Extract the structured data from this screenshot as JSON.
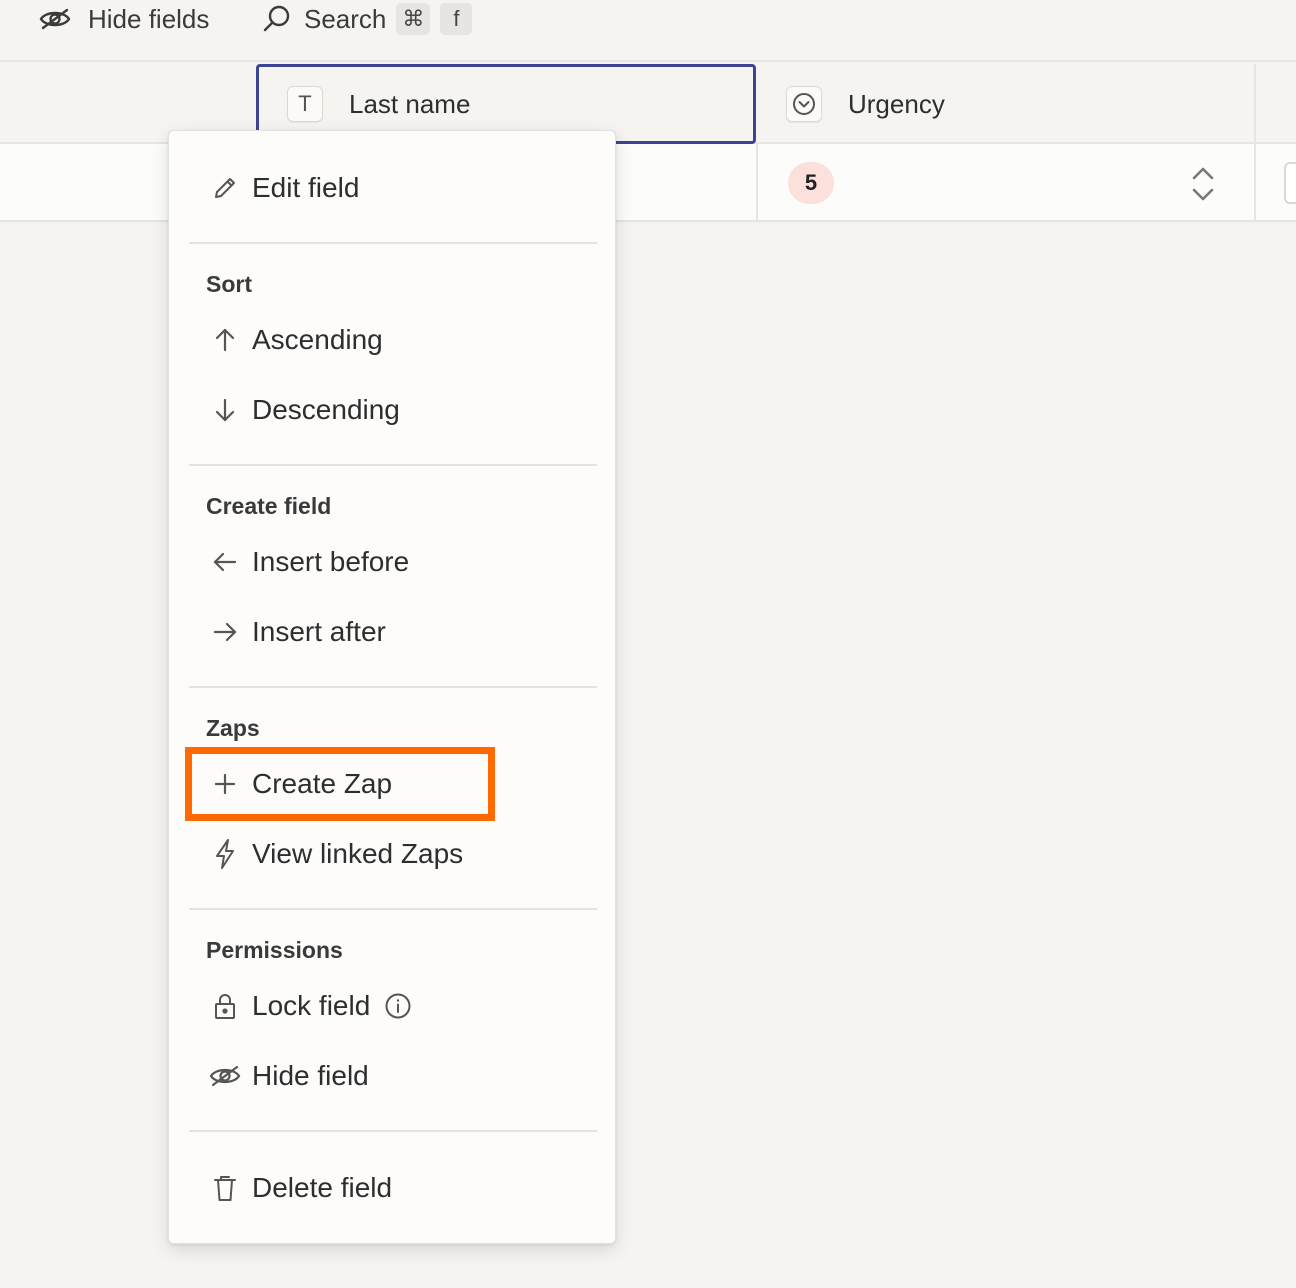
{
  "toolbar": {
    "hide_fields_label": "Hide fields",
    "search_label": "Search",
    "shortcut_keys": [
      "⌘",
      "f"
    ]
  },
  "columns": {
    "last_name": {
      "type_icon": "T",
      "title": "Last name"
    },
    "urgency": {
      "title": "Urgency"
    }
  },
  "row": {
    "urgency_value": "5"
  },
  "menu": {
    "edit_field": "Edit field",
    "sections": {
      "sort": "Sort",
      "create_field": "Create field",
      "zaps": "Zaps",
      "permissions": "Permissions"
    },
    "items": {
      "ascending": "Ascending",
      "descending": "Descending",
      "insert_before": "Insert before",
      "insert_after": "Insert after",
      "create_zap": "Create Zap",
      "view_linked_zaps": "View linked Zaps",
      "lock_field": "Lock field",
      "hide_field": "Hide field",
      "delete_field": "Delete field"
    }
  },
  "colors": {
    "selected_column_border": "#3d4592",
    "highlight_box": "#ff6a00",
    "urgency_badge_bg": "#fbe0dc"
  }
}
